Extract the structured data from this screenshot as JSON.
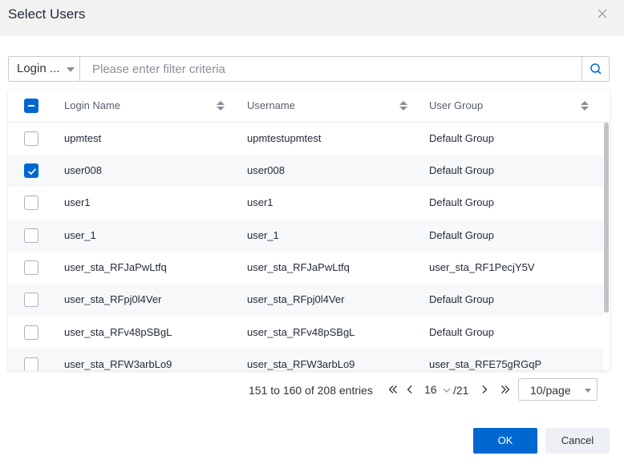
{
  "dialog": {
    "title": "Select Users"
  },
  "filter": {
    "field": "Login ...",
    "placeholder": "Please enter filter criteria",
    "value": ""
  },
  "table": {
    "columns": [
      "Login Name",
      "Username",
      "User Group"
    ],
    "rows": [
      {
        "checked": false,
        "login_name": "upmtest",
        "username": "upmtestupmtest",
        "user_group": "Default Group"
      },
      {
        "checked": true,
        "login_name": "user008",
        "username": "user008",
        "user_group": "Default Group"
      },
      {
        "checked": false,
        "login_name": "user1",
        "username": "user1",
        "user_group": "Default Group"
      },
      {
        "checked": false,
        "login_name": "user_1",
        "username": "user_1",
        "user_group": "Default Group"
      },
      {
        "checked": false,
        "login_name": "user_sta_RFJaPwLtfq",
        "username": "user_sta_RFJaPwLtfq",
        "user_group": "user_sta_RF1PecjY5V"
      },
      {
        "checked": false,
        "login_name": "user_sta_RFpj0l4Ver",
        "username": "user_sta_RFpj0l4Ver",
        "user_group": "Default Group"
      },
      {
        "checked": false,
        "login_name": "user_sta_RFv48pSBgL",
        "username": "user_sta_RFv48pSBgL",
        "user_group": "Default Group"
      },
      {
        "checked": false,
        "login_name": "user_sta_RFW3arbLo9",
        "username": "user_sta_RFW3arbLo9",
        "user_group": "user_sta_RFE75gRGqP"
      }
    ]
  },
  "pagination": {
    "info": "151 to 160 of 208 entries",
    "current_page": "16",
    "total_pages": "/21",
    "page_size": "10/page"
  },
  "buttons": {
    "ok": "OK",
    "cancel": "Cancel"
  },
  "colors": {
    "primary": "#0067d1",
    "header_bg": "#f2f2f2",
    "row_alt_bg": "#f7f8fa"
  }
}
